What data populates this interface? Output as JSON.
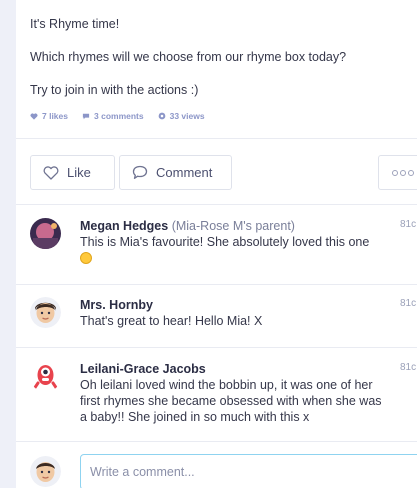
{
  "post": {
    "lines": [
      "It's Rhyme time!",
      "Which rhymes will we choose from our rhyme box today?",
      "Try to join in with the actions :)"
    ],
    "stats": {
      "likes": "7 likes",
      "comments": "3 comments",
      "views": "33 views"
    }
  },
  "actions": {
    "like_label": "Like",
    "comment_label": "Comment"
  },
  "comments": [
    {
      "author": "Megan Hedges",
      "relation": "(Mia-Rose M's parent)",
      "text": "This is Mia's favourite! She absolutely loved this one",
      "time": "81c"
    },
    {
      "author": "Mrs. Hornby",
      "text": "That's great to hear! Hello Mia! X",
      "time": "81c"
    },
    {
      "author": "Leilani-Grace Jacobs",
      "text": "Oh leilani loved wind the bobbin up, it was one of her first rhymes she became obsessed with when she was a baby!! She joined in so much with this x",
      "time": "81c"
    }
  ],
  "composer": {
    "placeholder": "Write a comment..."
  },
  "icons": {
    "likes": "heart-icon",
    "comments": "speech-bubble-icon",
    "views": "eye-icon",
    "more": "more-dots-icon"
  },
  "colors": {
    "stat": "#8c96c8",
    "input_focus": "#8fd3f0"
  }
}
